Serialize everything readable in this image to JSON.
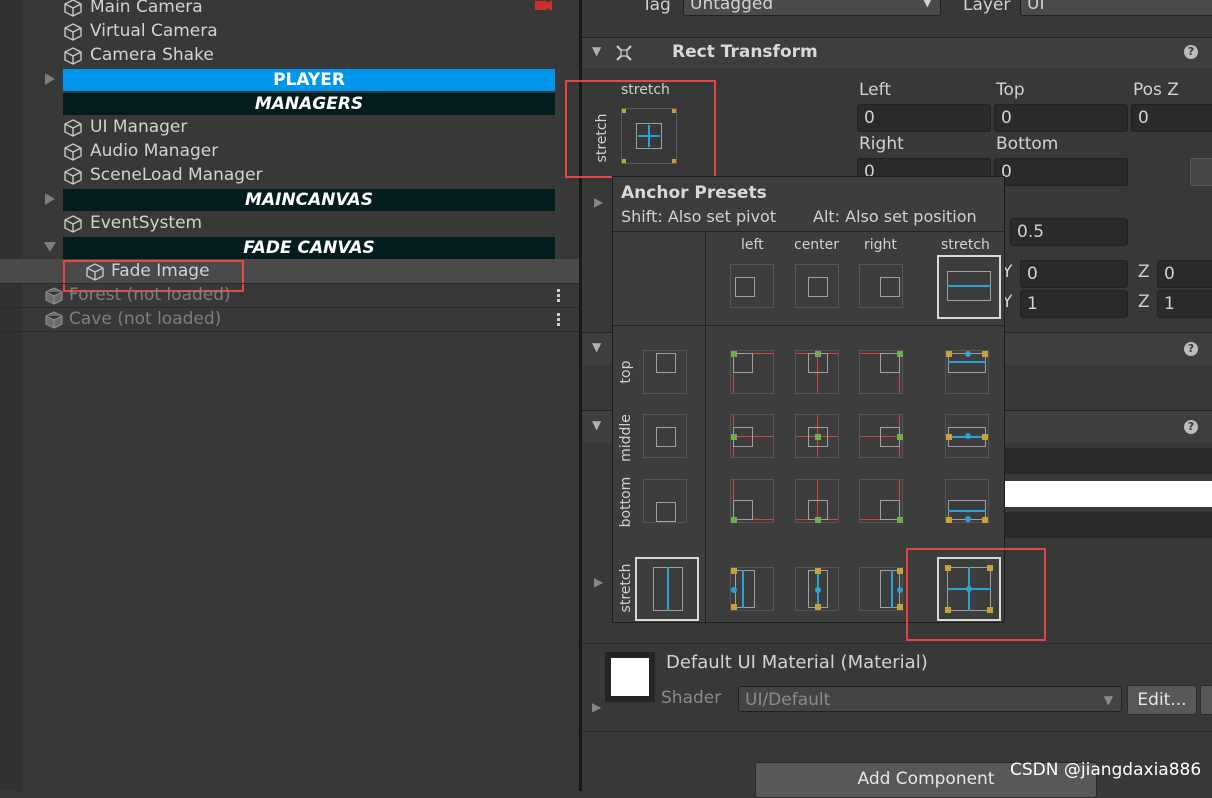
{
  "hierarchy": {
    "items": [
      {
        "label": "Main Camera"
      },
      {
        "label": "Virtual Camera"
      },
      {
        "label": "Camera Shake"
      },
      {
        "label": "PLAYER"
      },
      {
        "label": "MANAGERS"
      },
      {
        "label": "UI Manager"
      },
      {
        "label": "Audio Manager"
      },
      {
        "label": "SceneLoad Manager"
      },
      {
        "label": "MAINCANVAS"
      },
      {
        "label": "EventSystem"
      },
      {
        "label": "FADE CANVAS"
      },
      {
        "label": "Fade Image"
      }
    ],
    "scenes": [
      {
        "label": "Forest (not loaded)"
      },
      {
        "label": "Cave (not loaded)"
      }
    ]
  },
  "inspector": {
    "tag_label": "Tag",
    "tag_value": "Untagged",
    "layer_label": "Layer",
    "layer_value": "UI",
    "rect_transform_title": "Rect Transform",
    "anchor_widget": {
      "top_label": "stretch",
      "side_label": "stretch"
    },
    "fields": {
      "left_label": "Left",
      "left_value": "0",
      "top_label": "Top",
      "top_value": "0",
      "posz_label": "Pos Z",
      "posz_value": "0",
      "right_label": "Right",
      "right_value": "0",
      "bottom_label": "Bottom",
      "bottom_value": "0",
      "pivot_y_value": "0.5",
      "rot_y_label": "Y",
      "rot_y_value": "0",
      "rot_z_label": "Z",
      "rot_z_value": "0",
      "scale_y_label": "Y",
      "scale_y_value": "1",
      "scale_z_label": "Z",
      "scale_z_value": "1"
    },
    "material": {
      "title": "Default UI Material (Material)",
      "shader_label": "Shader",
      "shader_value": "UI/Default",
      "edit_button": "Edit..."
    },
    "add_component": "Add Component"
  },
  "anchor_popup": {
    "title": "Anchor Presets",
    "shift_hint": "Shift: Also set pivot",
    "alt_hint": "Alt: Also set position",
    "columns": [
      "left",
      "center",
      "right",
      "stretch"
    ],
    "rows": [
      "top",
      "middle",
      "bottom",
      "stretch"
    ]
  },
  "watermark": "CSDN @jiangdaxia886",
  "colors": {
    "selected_blue": "#0096ec",
    "header_dark": "#031c1e",
    "highlight_red": "#e64545",
    "anchor_blue": "#2aa3d4"
  }
}
